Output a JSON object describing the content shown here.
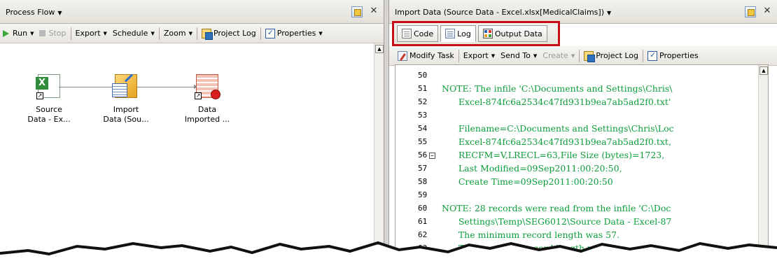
{
  "left": {
    "title": "Process Flow",
    "toolbar": {
      "run": "Run",
      "stop": "Stop",
      "export": "Export",
      "schedule": "Schedule",
      "zoom": "Zoom",
      "project_log": "Project Log",
      "properties": "Properties"
    },
    "nodes": [
      {
        "line1": "Source",
        "line2": "Data - Ex..."
      },
      {
        "line1": "Import",
        "line2": "Data (Sou..."
      },
      {
        "line1": "Data",
        "line2": "Imported ..."
      }
    ]
  },
  "right": {
    "title": "Import Data (Source Data - Excel.xlsx[MedicalClaims])",
    "tabs": [
      {
        "label": "Code",
        "icon": "code-icon"
      },
      {
        "label": "Log",
        "icon": "log-icon"
      },
      {
        "label": "Output Data",
        "icon": "output-data-icon"
      }
    ],
    "toolbar": {
      "modify_task": "Modify Task",
      "export": "Export",
      "send_to": "Send To",
      "create": "Create",
      "project_log": "Project Log",
      "properties": "Properties"
    },
    "log_lines": [
      {
        "n": "50",
        "text": ""
      },
      {
        "n": "51",
        "text": "NOTE: The infile 'C:\\Documents and Settings\\Chris\\"
      },
      {
        "n": "52",
        "text": "      Excel-874fc6a2534c47fd931b9ea7ab5ad2f0.txt'"
      },
      {
        "n": "53",
        "text": ""
      },
      {
        "n": "54",
        "text": "      Filename=C:\\Documents and Settings\\Chris\\Loc"
      },
      {
        "n": "55",
        "text": "      Excel-874fc6a2534c47fd931b9ea7ab5ad2f0.txt,"
      },
      {
        "n": "56",
        "text": "      RECFM=V,LRECL=63,File Size (bytes)=1723,"
      },
      {
        "n": "57",
        "text": "      Last Modified=09Sep2011:00:20:50,"
      },
      {
        "n": "58",
        "text": "      Create Time=09Sep2011:00:20:50"
      },
      {
        "n": "59",
        "text": ""
      },
      {
        "n": "60",
        "text": "NOTE: 28 records were read from the infile 'C:\\Doc"
      },
      {
        "n": "61",
        "text": "      Settings\\Temp\\SEG6012\\Source Data - Excel-87"
      },
      {
        "n": "62",
        "text": "      The minimum record length was 57."
      },
      {
        "n": "63",
        "text": "      The maximum record length was 6"
      }
    ]
  },
  "colors": {
    "highlight": "#c40f18",
    "log_text": "#0d9e3b"
  }
}
